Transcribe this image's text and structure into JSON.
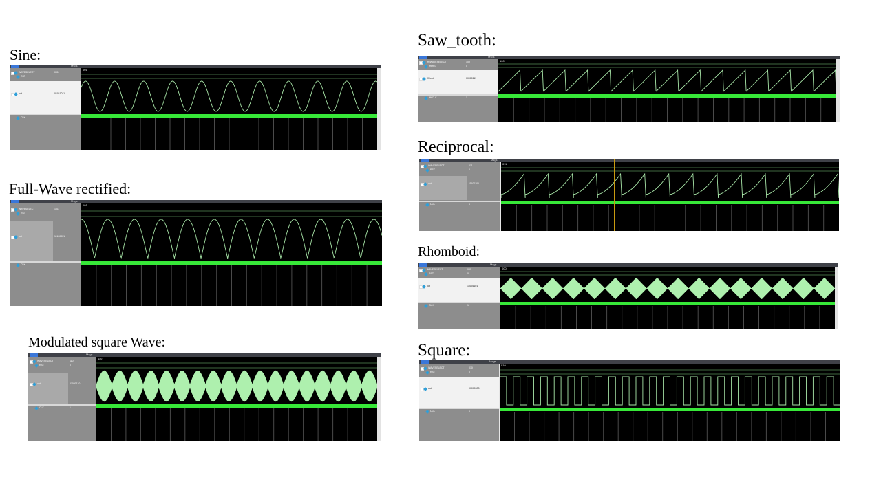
{
  "captions": {
    "sine": "Sine:",
    "saw_tooth": "Saw_tooth:",
    "reciprocal": "Reciprocal:",
    "full_wave": "Full-Wave rectified:",
    "rhomboid": "Rhomboid:",
    "modulated": "Modulated square Wave:",
    "square": "Square:"
  },
  "titlebar_label": "Msgs",
  "colors": {
    "waveform_bg": "#000000",
    "clock_green": "#37e838",
    "wave_line": "#a8e6a8",
    "envelope_fill": "#aef0ae",
    "grid": "#3c3c3c",
    "cursor": "#c89a10",
    "panel_gray": "#8d8d8d"
  },
  "panels": {
    "sine": {
      "signals": [
        "WAVESELECT",
        "RST",
        "out",
        "CLK"
      ],
      "values": [
        "001",
        "",
        "01011011",
        ""
      ],
      "bus_value": "001"
    },
    "saw_tooth": {
      "signals": [
        "/fft/WAVESELECT",
        "/fft/RST",
        "/fft/out",
        "/fft/CLK"
      ],
      "values": [
        "100",
        "0",
        "00010111",
        "1"
      ],
      "bus_value": "100"
    },
    "reciprocal": {
      "signals": [
        "WAVESELECT",
        "RST",
        "out",
        "CLK"
      ],
      "values": [
        "011",
        "0",
        "11100101",
        "1"
      ],
      "bus_value": "011"
    },
    "full_wave": {
      "signals": [
        "WAVESELECT",
        "RST",
        "out",
        "CLK"
      ],
      "values": [
        "101",
        "",
        "11100001",
        ""
      ],
      "bus_value": "101"
    },
    "rhomboid": {
      "signals": [
        "WAVESELECT",
        "RST",
        "out",
        "CLK"
      ],
      "values": [
        "000",
        "0",
        "10101101",
        "1"
      ],
      "bus_value": "000"
    },
    "modulated": {
      "signals": [
        "WAVESELECT",
        "RST",
        "out",
        "CLK"
      ],
      "values": [
        "110",
        "0",
        "01000110",
        "1"
      ],
      "bus_value": "110"
    },
    "square": {
      "signals": [
        "WAVESELECT",
        "RST",
        "out",
        "CLK"
      ],
      "values": [
        "010",
        "0",
        "00000000",
        "1"
      ],
      "bus_value": "010"
    }
  }
}
